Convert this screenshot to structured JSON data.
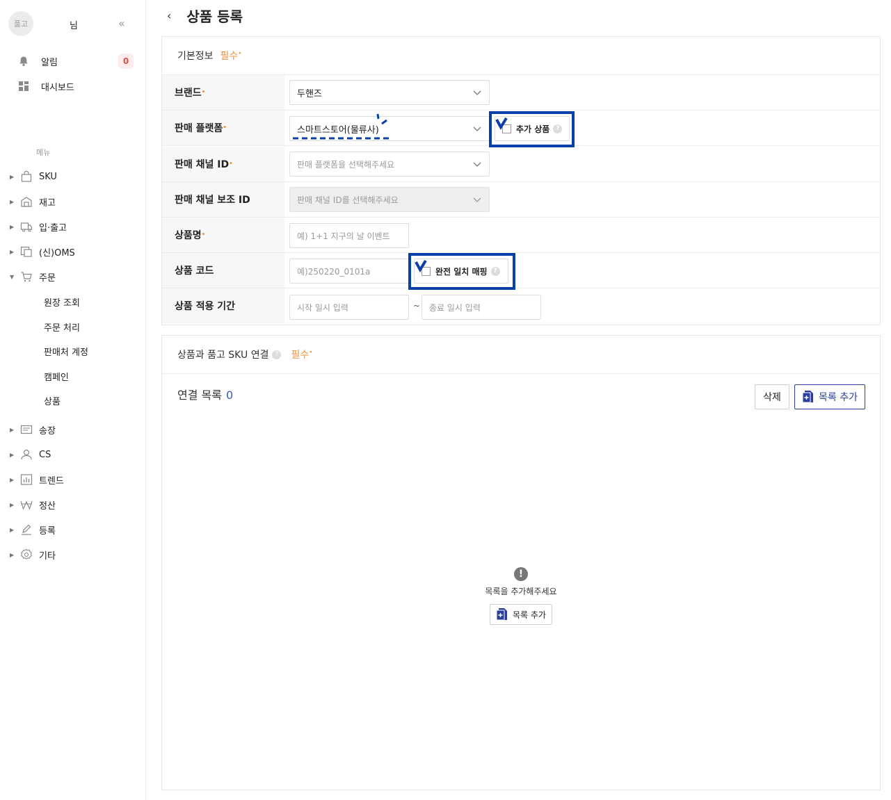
{
  "sidebar": {
    "avatar_text": "품고",
    "username": "님",
    "collapse_icon": "double-chevron-left-icon",
    "notifications": {
      "label": "알림",
      "count": "0"
    },
    "dashboard": {
      "label": "대시보드"
    },
    "menu_heading": "메뉴",
    "items": [
      {
        "label": "SKU"
      },
      {
        "label": "재고"
      },
      {
        "label": "입·출고"
      },
      {
        "label": "(신)OMS"
      },
      {
        "label": "주문"
      },
      {
        "label": "송장"
      },
      {
        "label": "CS"
      },
      {
        "label": "트렌드"
      },
      {
        "label": "정산"
      },
      {
        "label": "등록"
      },
      {
        "label": "기타"
      }
    ],
    "order_sub": [
      {
        "label": "원장 조회"
      },
      {
        "label": "주문 처리"
      },
      {
        "label": "판매처 계정"
      },
      {
        "label": "캠페인"
      },
      {
        "label": "상품"
      }
    ]
  },
  "header": {
    "title": "상품 등록"
  },
  "basic_info": {
    "title": "기본정보",
    "required": "필수",
    "fields": {
      "brand": {
        "label": "브랜드",
        "value": "두핸즈"
      },
      "platform": {
        "label": "판매 플랫폼",
        "value": "스마트스토어(물류사)",
        "extra_checkbox": "추가 상품"
      },
      "channel_id": {
        "label": "판매 채널 ID",
        "placeholder": "판매 플랫폼을 선택해주세요"
      },
      "sub_channel_id": {
        "label": "판매 채널 보조 ID",
        "placeholder": "판매 채널 ID를 선택해주세요"
      },
      "product_name": {
        "label": "상품명",
        "placeholder": "예) 1+1 지구의 날 이벤트"
      },
      "product_code": {
        "label": "상품 코드",
        "placeholder": "예)250220_0101a",
        "exact_match_checkbox": "완전 일치 매핑"
      },
      "period": {
        "label": "상품 적용 기간",
        "start_placeholder": "시작 일시 입력",
        "separator": "~",
        "end_placeholder": "종료 일시 입력"
      }
    }
  },
  "sku_link": {
    "title": "상품과 품고 SKU 연결",
    "required": "필수",
    "list_label": "연결 목록",
    "list_count": "0",
    "delete_label": "삭제",
    "add_label": "목록 추가",
    "empty_message": "목록을 추가해주세요",
    "empty_add_label": "목록 추가"
  },
  "colors": {
    "accent": "#2a3f9d",
    "required": "#f0923a",
    "highlight": "#0a3ea8"
  }
}
